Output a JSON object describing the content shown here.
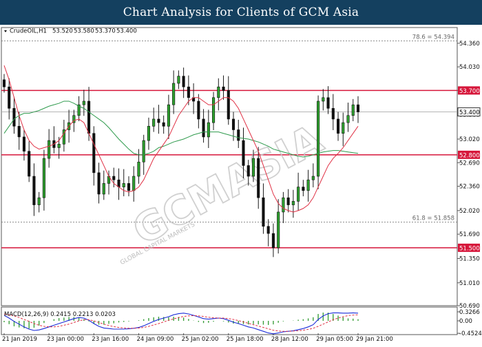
{
  "header": {
    "title": "Chart Analysis for Clients of GCM Asia"
  },
  "colors": {
    "header_bg": "#14405f",
    "level_line": "#d6163a",
    "ma_red": "#e03044",
    "ma_green": "#2e9a4c",
    "macd_line": "#1a2bd8",
    "signal_line": "#e03044",
    "histogram": "#3ca03c",
    "candle_body": "#2ea02e",
    "candle_wick": "#1a1a1a"
  },
  "chart_data": [
    {
      "type": "candlestick",
      "symbol_label": "CrudeOIL,H1",
      "ohlc_label": [
        "53.520",
        "53.580",
        "53.370",
        "53.400"
      ],
      "ylim": [
        50.69,
        54.58
      ],
      "y_ticks": [
        "54.360",
        "54.030",
        "53.700",
        "53.360",
        "53.020",
        "52.690",
        "52.360",
        "52.020",
        "51.690",
        "51.350",
        "51.010",
        "50.690"
      ],
      "x_labels": [
        "21 Jan 2019",
        "23 Jan 00:00",
        "23 Jan 16:00",
        "24 Jan 09:00",
        "25 Jan 02:00",
        "25 Jan 18:00",
        "28 Jan 12:00",
        "29 Jan 05:00",
        "29 Jan 21:00"
      ],
      "current_price": "53.400",
      "levels": [
        {
          "value": 53.7,
          "label": "53.700",
          "style": "solid"
        },
        {
          "value": 52.8,
          "label": "52.800",
          "style": "solid"
        },
        {
          "value": 51.5,
          "label": "51.500",
          "style": "solid"
        },
        {
          "value": 54.394,
          "label": "78.6 = 54.394",
          "style": "dashed"
        },
        {
          "value": 51.858,
          "label": "61.8 = 51.858",
          "style": "dashed"
        }
      ],
      "series": [
        {
          "name": "close",
          "type": "candles",
          "values": [
            53.75,
            53.45,
            53.2,
            53.05,
            52.85,
            52.5,
            52.1,
            52.2,
            52.75,
            53.0,
            52.9,
            52.95,
            53.15,
            53.25,
            53.35,
            53.5,
            53.55,
            53.1,
            52.55,
            52.25,
            52.4,
            52.5,
            52.45,
            52.35,
            52.4,
            52.3,
            52.5,
            52.7,
            53.0,
            53.2,
            53.3,
            53.25,
            53.2,
            53.5,
            53.8,
            53.9,
            53.75,
            53.6,
            53.55,
            53.3,
            53.05,
            53.25,
            53.6,
            53.75,
            53.7,
            53.3,
            53.15,
            53.0,
            52.65,
            52.5,
            52.75,
            52.2,
            51.8,
            51.7,
            51.5,
            52.0,
            52.2,
            52.1,
            52.15,
            52.35,
            52.3,
            52.45,
            52.5,
            53.55,
            53.6,
            53.45,
            53.3,
            53.1,
            53.25,
            53.35,
            53.5,
            53.4
          ]
        },
        {
          "name": "MA red",
          "type": "line",
          "values": [
            54.05,
            53.85,
            53.6,
            53.35,
            53.15,
            53.0,
            52.92,
            52.88,
            52.9,
            52.92,
            52.95,
            53.0,
            53.1,
            53.2,
            53.28,
            53.3,
            53.25,
            53.1,
            52.95,
            52.8,
            52.65,
            52.5,
            52.4,
            52.35,
            52.3,
            52.28,
            52.3,
            52.35,
            52.45,
            52.6,
            52.75,
            52.85,
            52.95,
            53.05,
            53.2,
            53.35,
            53.45,
            53.55,
            53.6,
            53.6,
            53.55,
            53.5,
            53.5,
            53.55,
            53.6,
            53.6,
            53.55,
            53.45,
            53.3,
            53.15,
            53.0,
            52.85,
            52.65,
            52.45,
            52.25,
            52.12,
            52.05,
            52.02,
            52.0,
            52.02,
            52.05,
            52.1,
            52.2,
            52.35,
            52.5,
            52.65,
            52.75,
            52.82,
            52.9,
            53.0,
            53.1,
            53.2
          ]
        },
        {
          "name": "MA green",
          "type": "line",
          "values": [
            53.1,
            53.2,
            53.3,
            53.35,
            53.38,
            53.38,
            53.4,
            53.42,
            53.45,
            53.48,
            53.5,
            53.52,
            53.55,
            53.55,
            53.52,
            53.48,
            53.45,
            53.4,
            53.35,
            53.3,
            53.25,
            53.18,
            53.1,
            53.02,
            52.95,
            52.88,
            52.82,
            52.8,
            52.8,
            52.82,
            52.85,
            52.9,
            52.92,
            52.95,
            52.98,
            53.0,
            53.02,
            53.05,
            53.08,
            53.1,
            53.12,
            53.12,
            53.12,
            53.12,
            53.1,
            53.08,
            53.06,
            53.04,
            53.03,
            53.02,
            53.0,
            52.98,
            52.95,
            52.92,
            52.88,
            52.86,
            52.84,
            52.82,
            52.8,
            52.78,
            52.77,
            52.78,
            52.8,
            52.82,
            52.84,
            52.85,
            52.86,
            52.86,
            52.85,
            52.84,
            52.83,
            52.82
          ]
        }
      ]
    },
    {
      "type": "macd",
      "label": "MACD(12,26,9) 0.2415 0.2213 0.0203",
      "ylim": [
        -0.45,
        0.4
      ],
      "y_ticks": [
        "0.3266",
        "0.00",
        "-0.4524"
      ],
      "series": [
        {
          "name": "MACD",
          "type": "line",
          "values": [
            0.2,
            0.1,
            -0.02,
            -0.12,
            -0.22,
            -0.3,
            -0.35,
            -0.33,
            -0.28,
            -0.22,
            -0.16,
            -0.1,
            -0.04,
            0.02,
            0.08,
            0.12,
            0.1,
            0.02,
            -0.1,
            -0.2,
            -0.26,
            -0.28,
            -0.3,
            -0.3,
            -0.3,
            -0.29,
            -0.27,
            -0.24,
            -0.18,
            -0.1,
            -0.02,
            0.05,
            0.1,
            0.15,
            0.22,
            0.26,
            0.28,
            0.25,
            0.2,
            0.14,
            0.08,
            0.06,
            0.08,
            0.1,
            0.08,
            0.02,
            -0.05,
            -0.1,
            -0.16,
            -0.22,
            -0.26,
            -0.32,
            -0.38,
            -0.44,
            -0.47,
            -0.44,
            -0.4,
            -0.38,
            -0.36,
            -0.32,
            -0.28,
            -0.22,
            -0.14,
            0.05,
            0.18,
            0.26,
            0.29,
            0.29,
            0.28,
            0.28,
            0.29,
            0.28
          ]
        },
        {
          "name": "Signal",
          "type": "line",
          "values": [
            0.25,
            0.22,
            0.18,
            0.12,
            0.05,
            -0.02,
            -0.1,
            -0.16,
            -0.2,
            -0.22,
            -0.22,
            -0.2,
            -0.16,
            -0.12,
            -0.06,
            0.0,
            0.04,
            0.04,
            0.0,
            -0.06,
            -0.12,
            -0.17,
            -0.21,
            -0.24,
            -0.26,
            -0.27,
            -0.27,
            -0.26,
            -0.24,
            -0.2,
            -0.15,
            -0.1,
            -0.04,
            0.02,
            0.07,
            0.12,
            0.16,
            0.18,
            0.19,
            0.18,
            0.16,
            0.13,
            0.11,
            0.1,
            0.1,
            0.08,
            0.05,
            0.01,
            -0.04,
            -0.09,
            -0.14,
            -0.19,
            -0.24,
            -0.29,
            -0.34,
            -0.37,
            -0.38,
            -0.38,
            -0.37,
            -0.36,
            -0.34,
            -0.31,
            -0.27,
            -0.2,
            -0.12,
            -0.04,
            0.04,
            0.1,
            0.15,
            0.19,
            0.21,
            0.22
          ]
        },
        {
          "name": "Histogram",
          "type": "bar",
          "values": [
            -0.05,
            -0.12,
            -0.2,
            -0.24,
            -0.27,
            -0.28,
            -0.25,
            -0.17,
            -0.08,
            0.0,
            0.06,
            0.1,
            0.12,
            0.14,
            0.14,
            0.12,
            0.06,
            -0.02,
            -0.1,
            -0.14,
            -0.14,
            -0.11,
            -0.09,
            -0.06,
            -0.04,
            -0.02,
            0.0,
            0.02,
            0.06,
            0.1,
            0.13,
            0.15,
            0.14,
            0.13,
            0.15,
            0.14,
            0.12,
            0.07,
            0.01,
            -0.04,
            -0.08,
            -0.07,
            -0.03,
            0.0,
            -0.02,
            -0.06,
            -0.1,
            -0.11,
            -0.12,
            -0.13,
            -0.12,
            -0.13,
            -0.14,
            -0.15,
            -0.13,
            -0.07,
            -0.02,
            0.0,
            0.01,
            0.04,
            0.06,
            0.09,
            0.13,
            0.25,
            0.3,
            0.3,
            0.25,
            0.19,
            0.13,
            0.09,
            0.08,
            0.06
          ]
        }
      ]
    }
  ],
  "watermark": {
    "main": "GCMASIA",
    "sub": "GLOBAL CAPITAL MARKETS"
  }
}
